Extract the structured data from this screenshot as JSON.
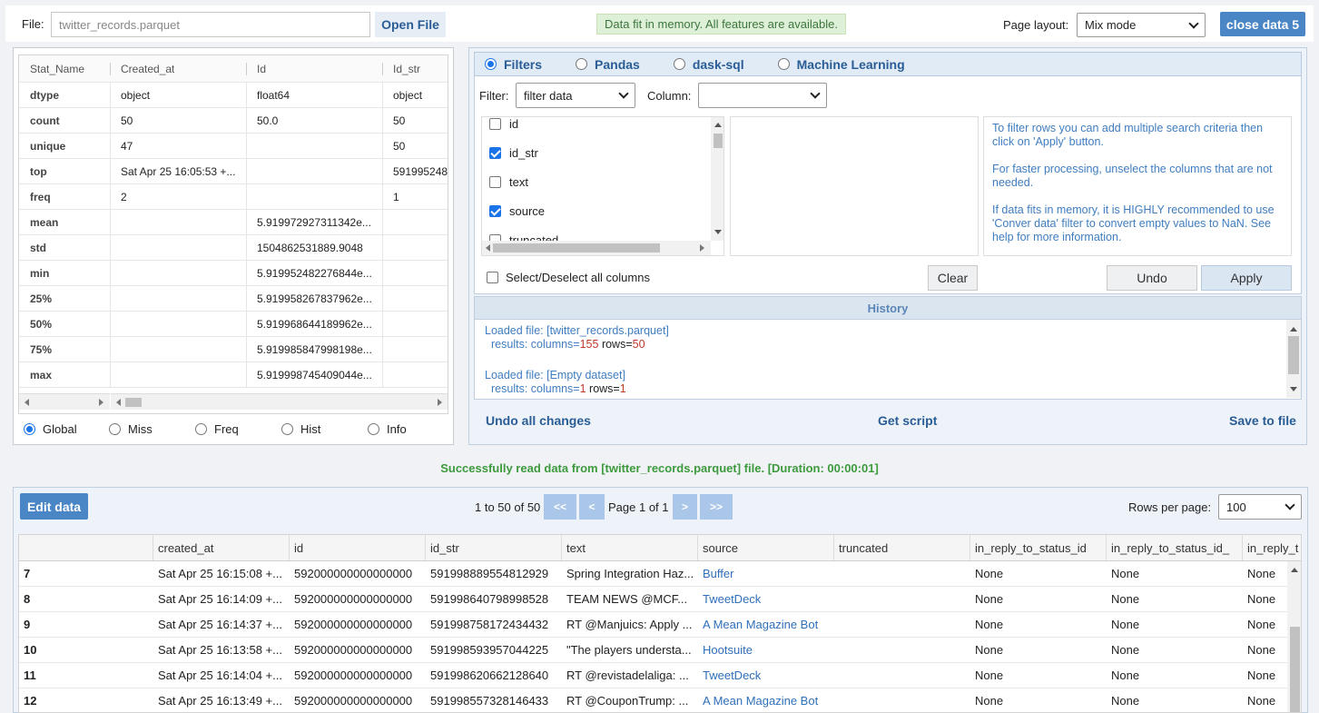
{
  "file": {
    "label": "File:",
    "filename": "twitter_records.parquet",
    "open_button": "Open File"
  },
  "status_badge": "Data fit in memory. All features are available.",
  "page_layout": {
    "label": "Page layout:",
    "value": "Mix mode"
  },
  "close_button": "close data 5",
  "stats": {
    "columns": [
      "Stat_Name",
      "Created_at",
      "Id",
      "Id_str"
    ],
    "rows": [
      [
        "dtype",
        "object",
        "float64",
        "object"
      ],
      [
        "count",
        "50",
        "50.0",
        "50"
      ],
      [
        "unique",
        "47",
        "",
        "50"
      ],
      [
        "top",
        "Sat Apr 25 16:05:53 +...",
        "",
        "591995248"
      ],
      [
        "freq",
        "2",
        "",
        "1"
      ],
      [
        "mean",
        "",
        "5.919972927311342e...",
        ""
      ],
      [
        "std",
        "",
        "1504862531889.9048",
        ""
      ],
      [
        "min",
        "",
        "5.919952482276844e...",
        ""
      ],
      [
        "25%",
        "",
        "5.919958267837962e...",
        ""
      ],
      [
        "50%",
        "",
        "5.919968644189962e...",
        ""
      ],
      [
        "75%",
        "",
        "5.919985847998198e...",
        ""
      ],
      [
        "max",
        "",
        "5.919998745409044e...",
        ""
      ]
    ],
    "modes": [
      "Global",
      "Miss",
      "Freq",
      "Hist",
      "Info"
    ],
    "selected_mode": "Global"
  },
  "tabs": [
    "Filters",
    "Pandas",
    "dask-sql",
    "Machine Learning"
  ],
  "selected_tab": "Filters",
  "filter": {
    "filter_label": "Filter:",
    "filter_value": "filter data",
    "column_label": "Column:",
    "column_value": "",
    "columns": [
      {
        "name": "id",
        "checked": false
      },
      {
        "name": "id_str",
        "checked": true
      },
      {
        "name": "text",
        "checked": false
      },
      {
        "name": "source",
        "checked": true
      },
      {
        "name": "truncated",
        "checked": false
      }
    ],
    "select_all_label": "Select/Deselect all columns",
    "help_text": [
      "To filter rows you can add multiple search criteria then click on 'Apply' button.",
      "For faster processing, unselect the columns that are not needed.",
      "If data fits in memory, it is HIGHLY recommended to use 'Conver data' filter to convert empty values to NaN. See help for more information."
    ],
    "clear_button": "Clear",
    "undo_button": "Undo",
    "apply_button": "Apply"
  },
  "history": {
    "title": "History",
    "entries": [
      {
        "loaded": "Loaded file: [twitter_records.parquet]",
        "results_prefix": "results: columns=",
        "columns": "155",
        "rows_prefix": " rows=",
        "rows": "50"
      },
      {
        "loaded": "Loaded file: [Empty dataset]",
        "results_prefix": "results: columns=",
        "columns": "1",
        "rows_prefix": " rows=",
        "rows": "1"
      }
    ]
  },
  "actions": {
    "undo_all": "Undo all changes",
    "get_script": "Get script",
    "save_to_file": "Save to file"
  },
  "success_message": "Successfully read data from [twitter_records.parquet] file. [Duration: 00:00:01]",
  "grid": {
    "edit_button": "Edit data",
    "range_text": "1 to 50 of 50",
    "page_text": "Page 1 of 1",
    "nav": {
      "first": "<<",
      "prev": "<",
      "next": ">",
      "last": ">>"
    },
    "rows_per_page_label": "Rows per page:",
    "rows_per_page": "100",
    "columns": [
      "",
      "created_at",
      "id",
      "id_str",
      "text",
      "source",
      "truncated",
      "in_reply_to_status_id",
      "in_reply_to_status_id_",
      "in_reply_t"
    ],
    "rows": [
      [
        "7",
        "Sat Apr 25 16:15:08 +...",
        "592000000000000000",
        "591998889554812929",
        "Spring Integration Haz...",
        "Buffer",
        "",
        "None",
        "None",
        "None"
      ],
      [
        "8",
        "Sat Apr 25 16:14:09 +...",
        "592000000000000000",
        "591998640798998528",
        "TEAM NEWS @MCF...",
        "TweetDeck",
        "",
        "None",
        "None",
        "None"
      ],
      [
        "9",
        "Sat Apr 25 16:14:37 +...",
        "592000000000000000",
        "591998758172434432",
        "RT @Manjuics: Apply ...",
        "A Mean Magazine Bot",
        "",
        "None",
        "None",
        "None"
      ],
      [
        "10",
        "Sat Apr 25 16:13:58 +...",
        "592000000000000000",
        "591998593957044225",
        "\"The players understa...",
        "Hootsuite",
        "",
        "None",
        "None",
        "None"
      ],
      [
        "11",
        "Sat Apr 25 16:14:04 +...",
        "592000000000000000",
        "591998620662128640",
        "RT @revistadelaliga: ...",
        "TweetDeck",
        "",
        "None",
        "None",
        "None"
      ],
      [
        "12",
        "Sat Apr 25 16:13:49 +...",
        "592000000000000000",
        "591998557328146433",
        "RT @CouponTrump: ...",
        "A Mean Magazine Bot",
        "",
        "None",
        "None",
        "None"
      ]
    ]
  }
}
